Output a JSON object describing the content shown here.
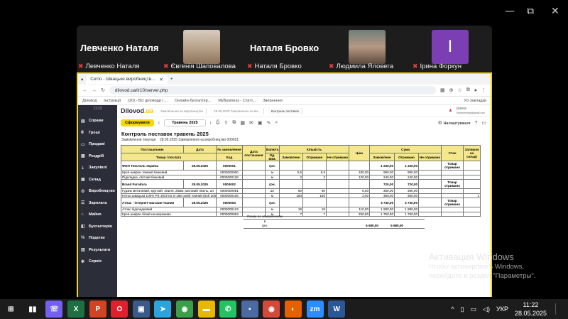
{
  "window_controls": {
    "minimize": "—",
    "restore": "⧉",
    "close": "✕"
  },
  "zoom": {
    "big_names": [
      "Левченко Наталя",
      "Наталя Бровко"
    ],
    "tile_letter": "І",
    "participants": [
      "Левченко Наталя",
      "Євгенія Шаповалова",
      "Наталя Бровко",
      "Людмила Яловега",
      "Ірина Форкун"
    ]
  },
  "browser": {
    "tab": "Сетіо - Швацьке виробництв...",
    "new_tab": "+",
    "url": "dilovod.ua/ir10/server.php",
    "bookmarks": [
      "Діловод",
      "Інструкції",
      "(20) - Всі діловоди | ...",
      "Онлайн-бухгалтер...",
      "MyBusiness - Статт...",
      "Звернення"
    ],
    "other_bookmarks": "Усі закладки"
  },
  "app": {
    "time": "11:22",
    "logo": "Dilovod",
    "logo_ua": ".ua",
    "tabs": [
      "Замовлення на виробництво",
      "28.05.2025 Замовлення на ви...",
      "Контроль поставок"
    ],
    "user": "Ірина",
    "user_email": "zamovlennya@gmail.com",
    "sidebar": [
      {
        "icon": "▤",
        "label": "Справи"
      },
      {
        "icon": "₴",
        "label": "Гроші"
      },
      {
        "icon": "▭",
        "label": "Продажі"
      },
      {
        "icon": "▦",
        "label": "Роздріб"
      },
      {
        "icon": "⇣",
        "label": "Закупівлі"
      },
      {
        "icon": "▣",
        "label": "Склад"
      },
      {
        "icon": "⚙",
        "label": "Виробництво"
      },
      {
        "icon": "☰",
        "label": "Зарплата"
      },
      {
        "icon": "⌂",
        "label": "Майно"
      },
      {
        "icon": "◧",
        "label": "Бухгалтерія"
      },
      {
        "icon": "%",
        "label": "Податки"
      },
      {
        "icon": "▥",
        "label": "Результати"
      },
      {
        "icon": "✱",
        "label": "Сервіс"
      }
    ],
    "toolbar": {
      "form_button": "Сформувати",
      "period": "Травень 2025",
      "settings": "Налаштування"
    },
    "report": {
      "title": "Контроль поставок травень 2025",
      "subtitle_label": "Замовлення покупця",
      "subtitle_value": "28.05.2025 Замовлення на виробництво 000021",
      "headers": {
        "supplier": "Постачальник",
        "date": "Дата",
        "order_no": "№ замовлення",
        "supply_date": "Дата постачання",
        "currency": "Валюта",
        "qty": "Кількість",
        "price": "Ціна",
        "sum": "Сума",
        "state": "Стан",
        "rest": "Залишок на складі",
        "goods": "Товар / послуга",
        "code": "Код",
        "unit": "Од. вим.",
        "ordered": "Замовлено",
        "received": "Отримано",
        "not_received": "Не отримано"
      },
      "rows": [
        {
          "g": true,
          "a": "ФОП Текстиль Україна",
          "b": "28.05.2025",
          "c": "0000001",
          "e": "грн.",
          "j": "1 230,00",
          "k": "1 230,00",
          "m": "Товар отримано"
        },
        {
          "a": "Креп-шифон темний бежевий",
          "c": "0000000060",
          "e": "м",
          "f": "5,5",
          "g2": "5,5",
          "i": "180,00",
          "j": "990,00",
          "k": "990,00"
        },
        {
          "a": "Підкладка, світлий бежевий",
          "c": "0000000128",
          "e": "м",
          "f": "2",
          "g2": "2",
          "i": "120,00",
          "j": "240,00",
          "k": "240,00"
        },
        {
          "g": true,
          "a": "Brand Furnitura",
          "b": "28.05.2025",
          "c": "0000002",
          "e": "грн.",
          "j": "720,00",
          "k": "720,00",
          "m": "Товар отримано"
        },
        {
          "a": "Гудзик металевий, круглий, Хвиля, 25мм, матовий нікель, шт",
          "c": "0000000091",
          "e": "шт",
          "f": "60",
          "g2": "60",
          "i": "6,00",
          "j": "360,00",
          "k": "360,00"
        },
        {
          "a": "Нитка швацька 100% PE 20/3 kor.S-168 синій темний (6об 2000ярдів) МН",
          "c": "0000000106",
          "e": "м",
          "f": "180",
          "g2": "180",
          "i": "2,00",
          "j": "360,00",
          "k": "360,00",
          "n": "1"
        },
        {
          "g": true,
          "a": "Атлас - інтернет-магазин тканин",
          "b": "28.05.2025",
          "c": "0000003",
          "e": "грн.",
          "j": "3 730,00",
          "k": "3 730,00",
          "m": "Товар отримано"
        },
        {
          "a": "Атлас підкладковий",
          "c": "0000000124",
          "e": "м",
          "f": "18",
          "g2": "18",
          "i": "110,00",
          "j": "1 980,00",
          "k": "1 980,00"
        },
        {
          "a": "Креп-шифон білий на мереживо",
          "c": "0000000063",
          "e": "м",
          "f": "7",
          "g2": "7",
          "i": "250,00",
          "j": "1 750,00",
          "k": "1 750,00"
        }
      ],
      "total_label": "Разом по замовленням",
      "total_label2": "в",
      "total_currency": "грн.",
      "total_ordered": "5 680,00",
      "total_received": "5 680,00"
    }
  },
  "activation": {
    "title": "Активация Windows",
    "line1": "Чтобы активировать Windows,",
    "line2": "перейдите в раздел \"Параметры\"."
  },
  "taskbar": {
    "apps": [
      {
        "name": "windows-start-icon",
        "glyph": "⊞",
        "color": "#1c1c1c"
      },
      {
        "name": "task-view-icon",
        "glyph": "▮▮",
        "color": "#1c1c1c"
      },
      {
        "name": "viber-icon",
        "glyph": "☏",
        "color": "#7360f2"
      },
      {
        "name": "excel-icon",
        "glyph": "X",
        "color": "#1d7044"
      },
      {
        "name": "powerpoint-icon",
        "glyph": "P",
        "color": "#d04423"
      },
      {
        "name": "opera-icon",
        "glyph": "O",
        "color": "#e0202d"
      },
      {
        "name": "device-manager-icon",
        "glyph": "▣",
        "color": "#3a5a8a"
      },
      {
        "name": "telegram-icon",
        "glyph": "➤",
        "color": "#2aa3df"
      },
      {
        "name": "chrome-icon",
        "glyph": "◉",
        "color": "#3b9e4a"
      },
      {
        "name": "file-explorer-icon",
        "glyph": "▬",
        "color": "#e6b800"
      },
      {
        "name": "whatsapp-icon",
        "glyph": "✆",
        "color": "#25c263"
      },
      {
        "name": "save-icon",
        "glyph": "▪",
        "color": "#4b6aa3"
      },
      {
        "name": "chrome-2-icon",
        "glyph": "◉",
        "color": "#d44a3a"
      },
      {
        "name": "firefox-icon",
        "glyph": "◐",
        "color": "#e66000"
      },
      {
        "name": "zoom-icon",
        "glyph": "zm",
        "color": "#2d8cff"
      },
      {
        "name": "word-icon",
        "glyph": "W",
        "color": "#2b5797"
      }
    ],
    "tray": {
      "chevron": "^",
      "language": "УКР",
      "time": "11:22",
      "date": "28.05.2025"
    }
  }
}
